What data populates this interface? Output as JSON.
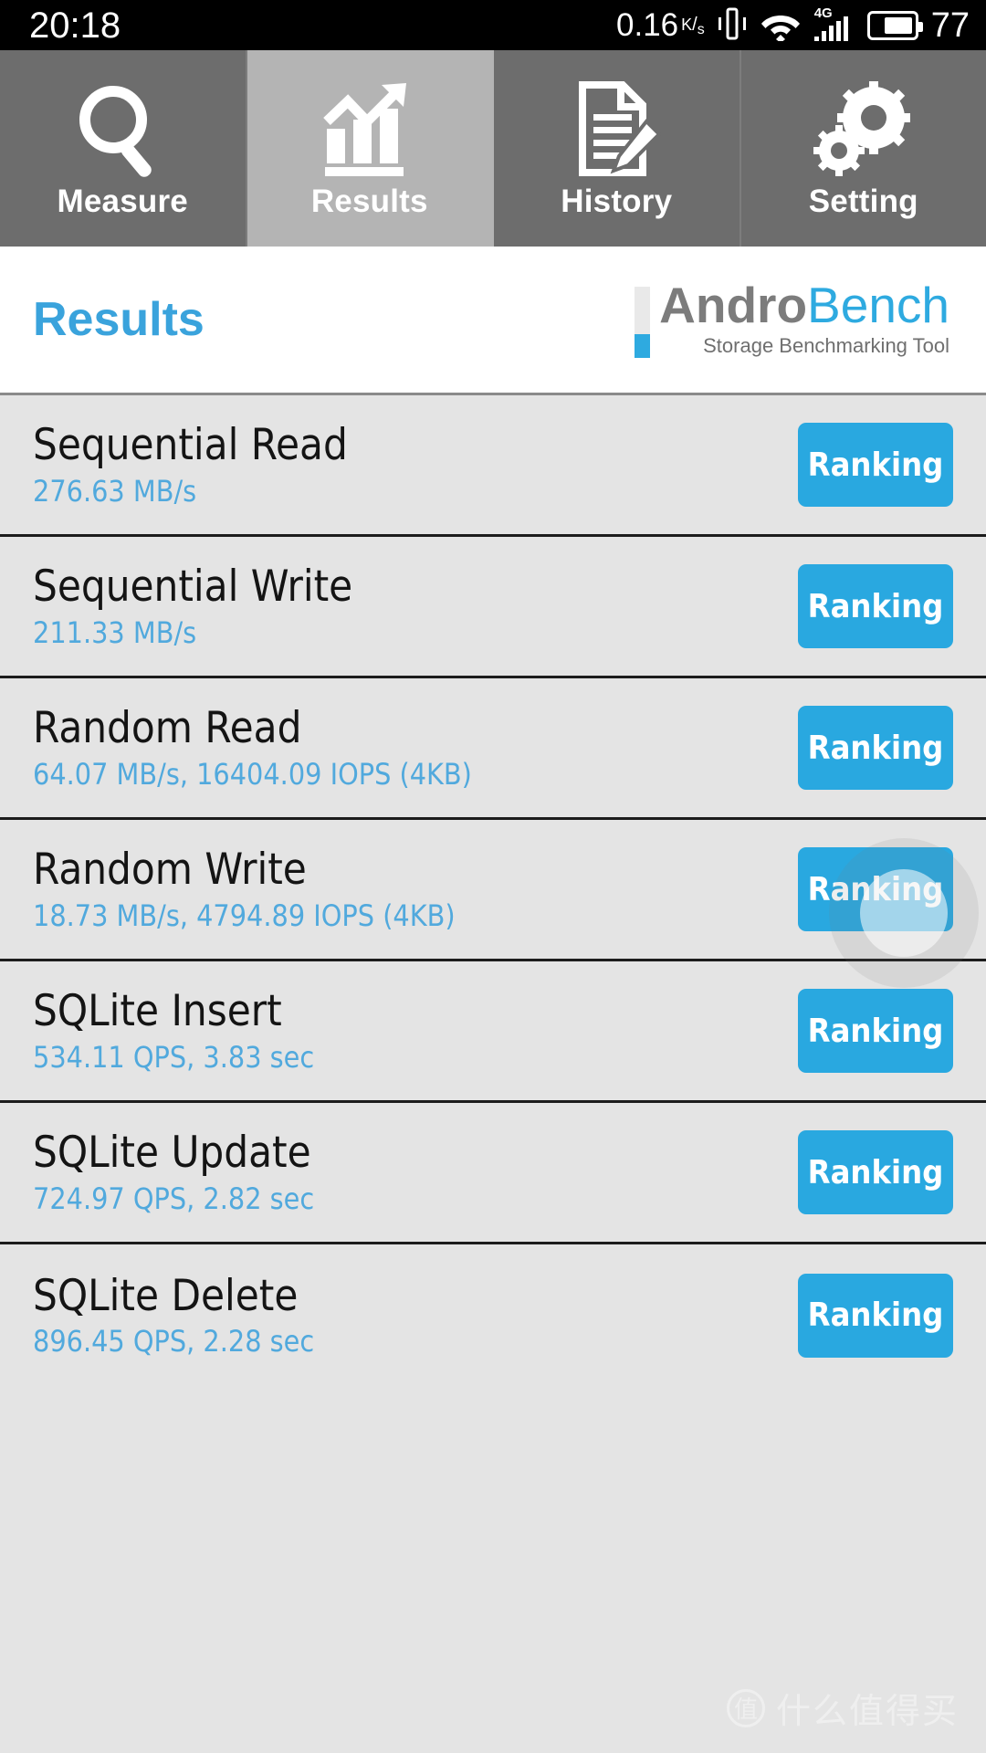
{
  "statusbar": {
    "clock": "20:18",
    "net_speed_value": "0.16",
    "net_speed_unit_k": "K",
    "net_speed_unit_slash": "/",
    "net_speed_unit_s": "s",
    "vibrate_icon": "vibrate-icon",
    "wifi_icon": "wifi-icon",
    "network_type": "4G",
    "signal_icon": "signal-bars-icon",
    "battery_icon": "battery-icon",
    "battery_percent": "77"
  },
  "tabs": [
    {
      "label": "Measure",
      "icon": "magnifier-icon",
      "active": false
    },
    {
      "label": "Results",
      "icon": "bar-chart-trend-icon",
      "active": true
    },
    {
      "label": "History",
      "icon": "document-pencil-icon",
      "active": false
    },
    {
      "label": "Setting",
      "icon": "gears-icon",
      "active": false
    }
  ],
  "header": {
    "title": "Results",
    "brand_prefix": "Andro",
    "brand_suffix": "Bench",
    "brand_tagline": "Storage Benchmarking Tool"
  },
  "rows": [
    {
      "title": "Sequential Read",
      "value": "276.63 MB/s",
      "button": "Ranking"
    },
    {
      "title": "Sequential Write",
      "value": "211.33 MB/s",
      "button": "Ranking"
    },
    {
      "title": "Random Read",
      "value": "64.07 MB/s, 16404.09 IOPS (4KB)",
      "button": "Ranking"
    },
    {
      "title": "Random Write",
      "value": "18.73 MB/s, 4794.89 IOPS (4KB)",
      "button": "Ranking"
    },
    {
      "title": "SQLite Insert",
      "value": "534.11 QPS, 3.83 sec",
      "button": "Ranking"
    },
    {
      "title": "SQLite Update",
      "value": "724.97 QPS, 2.82 sec",
      "button": "Ranking"
    },
    {
      "title": "SQLite Delete",
      "value": "896.45 QPS, 2.28 sec",
      "button": "Ranking"
    }
  ],
  "watermark": {
    "badge": "值",
    "text": "什么值得买"
  },
  "colors": {
    "accent_blue": "#29a8e0",
    "value_blue": "#51a9dd",
    "title_blue": "#3aa3dc",
    "tab_inactive": "#6d6d6d",
    "tab_active": "#b4b4b4",
    "list_bg": "#e4e4e4"
  }
}
